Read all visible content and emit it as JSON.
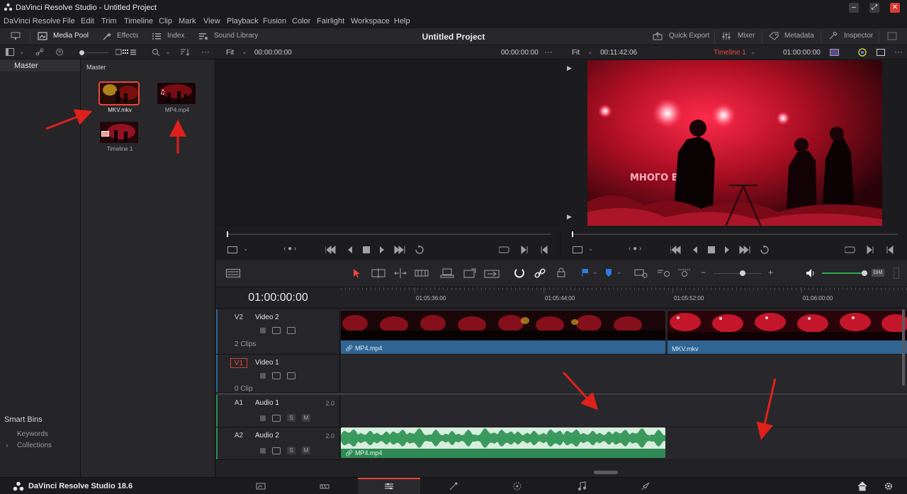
{
  "app": {
    "window_title": "DaVinci Resolve Studio - Untitled Project",
    "project_title": "Untitled Project",
    "brand": "DaVinci Resolve Studio 18.6"
  },
  "menu": [
    "DaVinci Resolve",
    "File",
    "Edit",
    "Trim",
    "Timeline",
    "Clip",
    "Mark",
    "View",
    "Playback",
    "Fusion",
    "Color",
    "Fairlight",
    "Workspace",
    "Help"
  ],
  "toolbar": {
    "media_pool": "Media Pool",
    "effects": "Effects",
    "index": "Index",
    "sound_library": "Sound Library",
    "quick_export": "Quick Export",
    "mixer": "Mixer",
    "metadata": "Metadata",
    "inspector": "Inspector"
  },
  "bins": {
    "master": "Master",
    "smart_bins": "Smart Bins",
    "keywords": "Keywords",
    "collections": "Collections"
  },
  "media_pool": {
    "title": "Master",
    "clips": [
      {
        "name": "MKV.mkv",
        "selected": true
      },
      {
        "name": "MP4.mp4",
        "selected": false
      },
      {
        "name": "Timeline 1",
        "selected": false
      }
    ]
  },
  "source_viewer": {
    "zoom": "Fit",
    "timecode_left": "00:00:00:00",
    "timecode_right": "00:00:00:00"
  },
  "timeline_viewer": {
    "zoom": "Fit",
    "duration": "00:11:42:06",
    "timeline_name": "Timeline 1",
    "timecode": "01:00:00:00"
  },
  "timeline": {
    "current_tc": "01:00:00:00",
    "ruler": [
      "01:05:36:00",
      "01:05:44:00",
      "01:05:52:00",
      "01:06:00:00"
    ],
    "tracks": [
      {
        "id": "V2",
        "name": "Video 2",
        "count": "2 Clips"
      },
      {
        "id": "V1",
        "name": "Video 1",
        "count": "0 Clip"
      },
      {
        "id": "A1",
        "name": "Audio 1",
        "vol": "2.0"
      },
      {
        "id": "A2",
        "name": "Audio 2",
        "vol": "2.0"
      }
    ],
    "clips": {
      "v2_a": "MP4.mp4",
      "v2_b": "MKV.mkv",
      "a2_a": "MP4.mp4"
    },
    "solo": "S",
    "mute": "M",
    "dim": "DIM"
  },
  "colors": {
    "accent_red": "#e8463c",
    "video_clip": "#2f6493",
    "audio_clip": "#2f8a55"
  }
}
